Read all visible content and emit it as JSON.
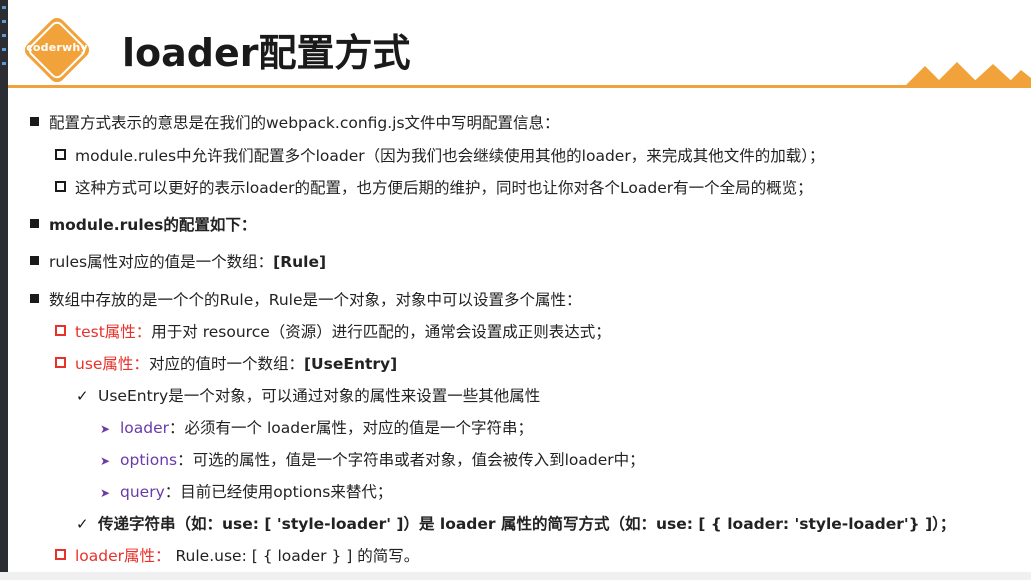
{
  "slide": {
    "logo_text": "coderwhy",
    "title": "loader配置方式",
    "accent_color": "#f1a23a",
    "highlight_red": "#e8312b",
    "highlight_purple": "#6a3aa8"
  },
  "lines": {
    "l1": "配置方式表示的意思是在我们的webpack.config.js文件中写明配置信息：",
    "l2": "module.rules中允许我们配置多个loader（因为我们也会继续使用其他的loader，来完成其他文件的加载）；",
    "l3": "这种方式可以更好的表示loader的配置，也方便后期的维护，同时也让你对各个Loader有一个全局的概览；",
    "l4": "module.rules的配置如下：",
    "l5_prefix": "rules属性对应的值是一个数组：",
    "l5_bold": "[Rule]",
    "l6": "数组中存放的是一个个的Rule，Rule是一个对象，对象中可以设置多个属性：",
    "l7_key": "test属性：",
    "l7_text": "用于对 resource（资源）进行匹配的，通常会设置成正则表达式；",
    "l8_key": "use属性：",
    "l8_text": "对应的值时一个数组：",
    "l8_bold": "[UseEntry]",
    "l9": "UseEntry是一个对象，可以通过对象的属性来设置一些其他属性",
    "l10_key": "loader",
    "l10_text": "：必须有一个 loader属性，对应的值是一个字符串；",
    "l11_key": "options",
    "l11_text": "：可选的属性，值是一个字符串或者对象，值会被传入到loader中；",
    "l12_key": "query",
    "l12_text": "：目前已经使用options来替代；",
    "l13": "传递字符串（如：use: [ 'style-loader' ]）是 loader 属性的简写方式（如：use: [ { loader: 'style-loader'} ]）；",
    "l14_key": "loader属性：",
    "l14_text": " Rule.use: [ { loader } ] 的简写。"
  }
}
